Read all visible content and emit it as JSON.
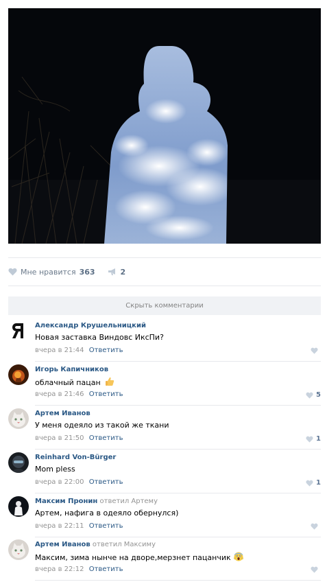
{
  "post": {
    "likes_label": "Мне нравится",
    "likes_count": "363",
    "shares_count": "2",
    "hide_comments_label": "Скрыть комментарии"
  },
  "comments": [
    {
      "author": "Александр Крушельницкий",
      "replied_to": "",
      "text": "Новая заставка Виндовс ИксПи?",
      "time": "вчера в 21:44",
      "reply_label": "Ответить",
      "likes": ""
    },
    {
      "author": "Игорь Капичников",
      "replied_to": "",
      "text": "облачный пацан",
      "time": "вчера в 21:46",
      "reply_label": "Ответить",
      "likes": "5"
    },
    {
      "author": "Артем Иванов",
      "replied_to": "",
      "text": "У меня одеяло из такой же ткани",
      "time": "вчера в 21:50",
      "reply_label": "Ответить",
      "likes": "1"
    },
    {
      "author": "Reinhard Von-Bürger",
      "replied_to": "",
      "text": "Mom pless",
      "time": "вчера в 22:00",
      "reply_label": "Ответить",
      "likes": "1"
    },
    {
      "author": "Максим Пронин",
      "replied_to": "ответил Артему",
      "text": "Артем, нафига в одеяло обернулся)",
      "time": "вчера в 22:11",
      "reply_label": "Ответить",
      "likes": ""
    },
    {
      "author": "Артем Иванов",
      "replied_to": "ответил Максиму",
      "text": "Максим, зима нынче на дворе,мерзнет пацанчик",
      "time": "вчера в 22:12",
      "reply_label": "Ответить",
      "likes": ""
    }
  ],
  "colors": {
    "link": "#2a5885",
    "muted": "#939393",
    "divider": "#e7e8ec",
    "hide_bar_bg": "#f0f2f5"
  },
  "icons": {
    "like": "heart-icon",
    "share": "megaphone-icon",
    "emoji_1": "thumbs-up-emoji",
    "emoji_2": "screaming-face-emoji"
  }
}
